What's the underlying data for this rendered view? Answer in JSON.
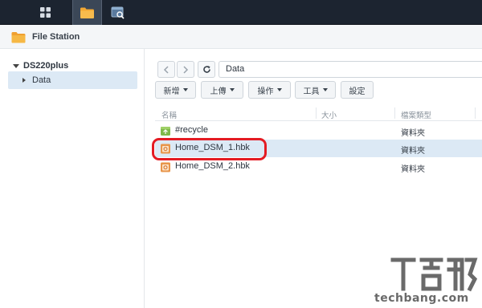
{
  "taskbar": {
    "main_menu_icon": "grid-icon",
    "file_station_icon": "folder-icon",
    "other_app_icon": "search-window-icon"
  },
  "window": {
    "title": "File Station",
    "title_icon": "folder-icon"
  },
  "sidebar": {
    "root_label": "DS220plus",
    "items": [
      {
        "label": "Data",
        "selected": true
      }
    ]
  },
  "navigation": {
    "back_icon": "chevron-left-icon",
    "forward_icon": "chevron-right-icon",
    "refresh_icon": "refresh-icon",
    "path": "Data"
  },
  "toolbar": {
    "new_label": "新增",
    "upload_label": "上傳",
    "action_label": "操作",
    "tools_label": "工具",
    "settings_label": "設定"
  },
  "table": {
    "columns": [
      "名稱",
      "大小",
      "檔案類型"
    ],
    "rows": [
      {
        "name": "#recycle",
        "size": "",
        "type": "資料夾",
        "icon": "recycle-folder-icon",
        "selected": false
      },
      {
        "name": "Home_DSM_1.hbk",
        "size": "",
        "type": "資料夾",
        "icon": "backup-folder-icon",
        "selected": true
      },
      {
        "name": "Home_DSM_2.hbk",
        "size": "",
        "type": "資料夾",
        "icon": "backup-folder-icon",
        "selected": false
      }
    ]
  },
  "annotation": {
    "highlight_color": "#e41b23"
  },
  "watermark": {
    "text": "techbang.com"
  },
  "colors": {
    "taskbar": "#1c2430",
    "selection": "#dce9f5",
    "folder": "#f0a030"
  }
}
